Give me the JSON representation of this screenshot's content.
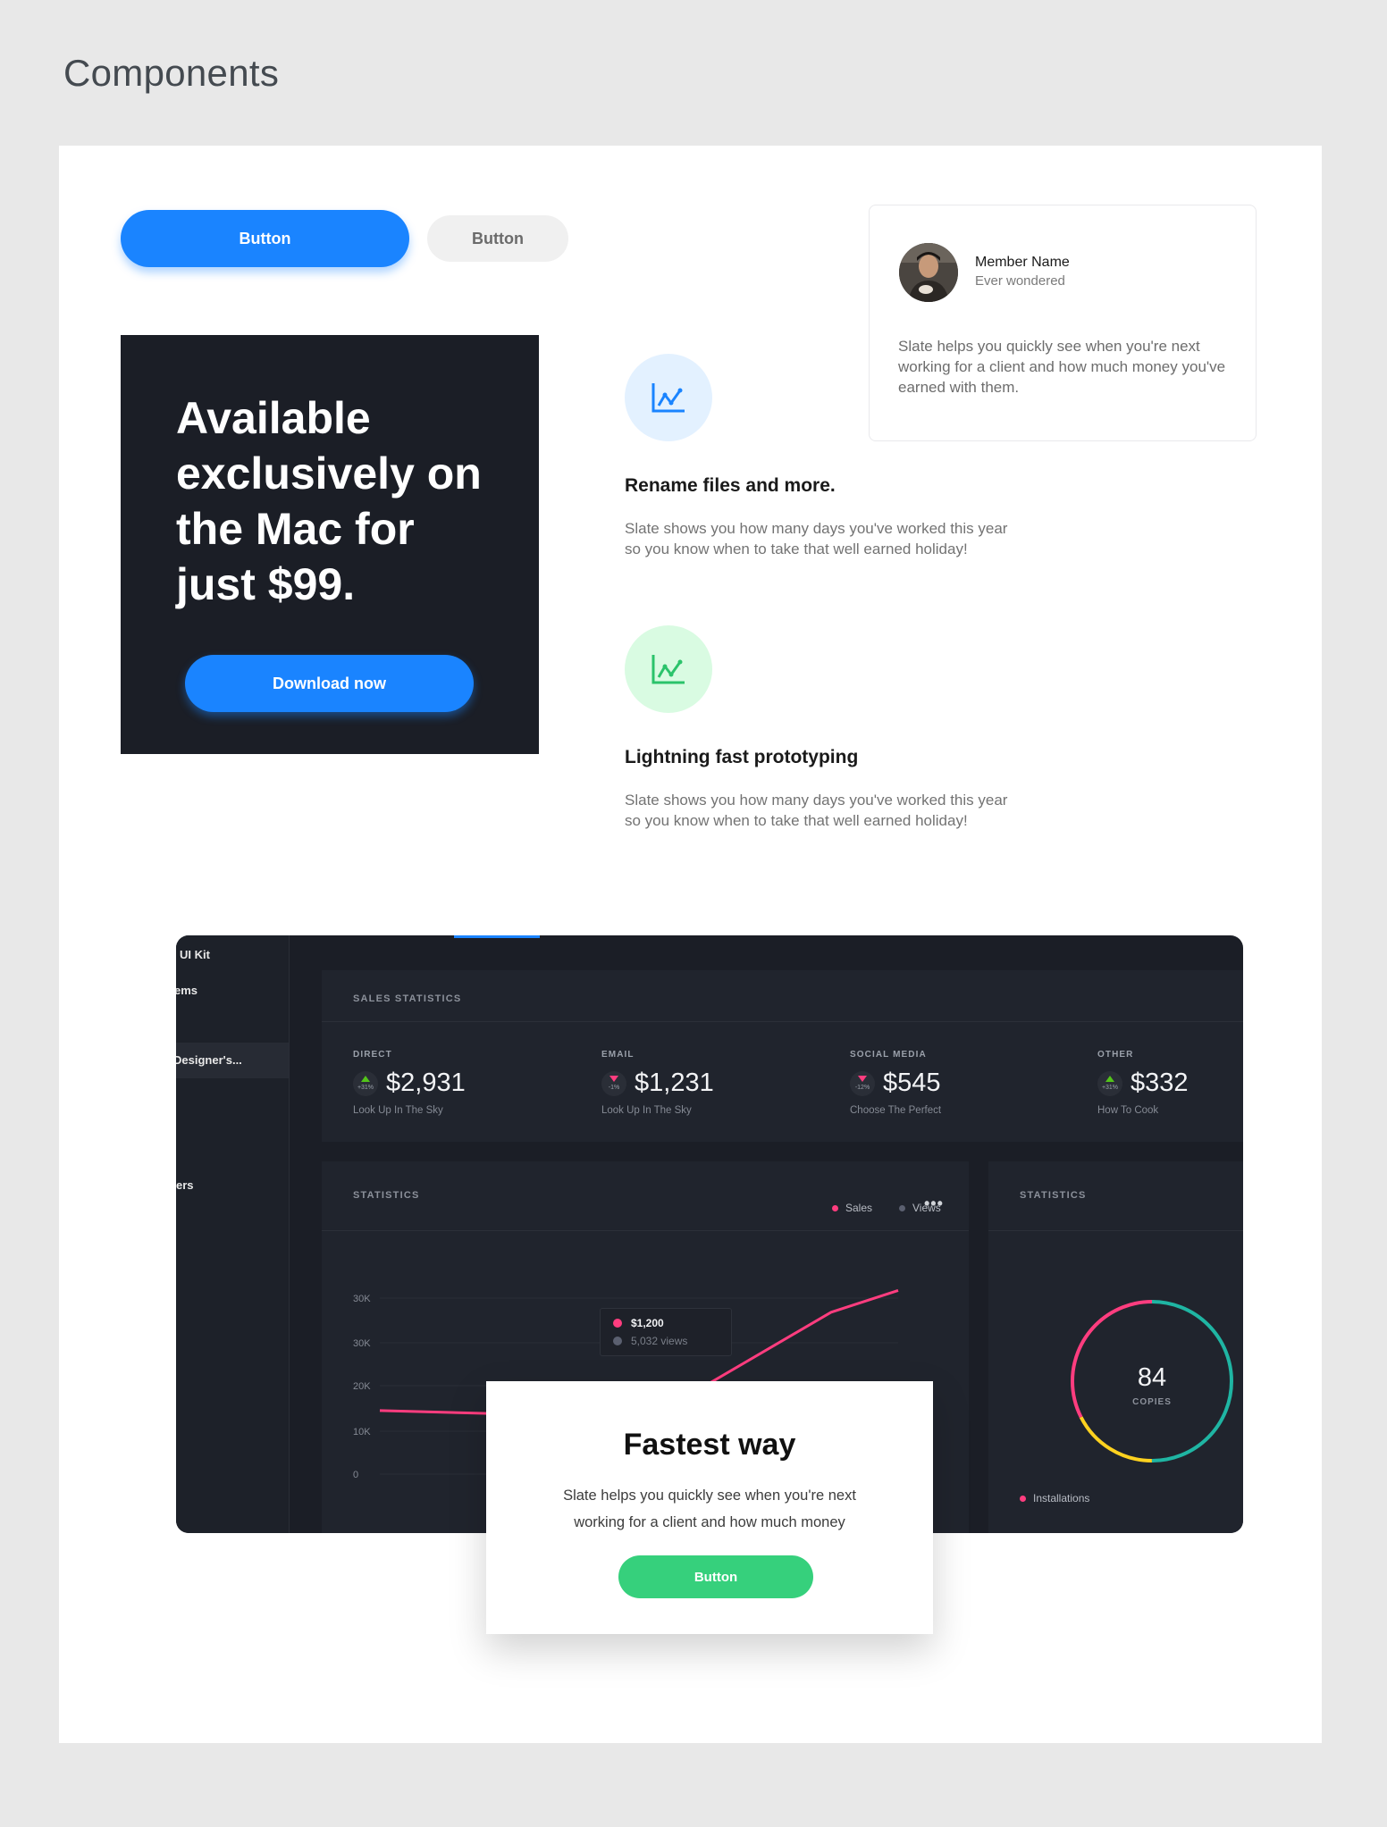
{
  "page": {
    "title": "Components"
  },
  "buttons": {
    "primary_label": "Button",
    "secondary_label": "Button"
  },
  "promo": {
    "headline": "Available exclusively on the Mac for just $99.",
    "cta_label": "Download now"
  },
  "features": [
    {
      "icon": "line-chart-icon",
      "title": "Rename files and more.",
      "description": "Slate shows you how many days you've worked this year so you know when to take that well earned holiday!",
      "icon_color": "#1a84ff",
      "bg_color": "#e3f1ff"
    },
    {
      "icon": "line-chart-icon",
      "title": "Lightning fast prototyping",
      "description": "Slate shows you how many days you've worked this year so you know when to take that well earned holiday!",
      "icon_color": "#2bc36b",
      "bg_color": "#d9fbe2"
    }
  ],
  "member_card": {
    "name": "Member Name",
    "subtitle": "Ever wondered",
    "text": "Slate helps you quickly see when you're next working for a client and how much money you've earned with them."
  },
  "dashboard": {
    "sidebar": [
      "UI Kit",
      "ems",
      "Designer's...",
      "ers"
    ],
    "sales_title": "SALES STATISTICS",
    "stats": [
      {
        "label": "DIRECT",
        "value": "$2,931",
        "change": "+31%",
        "trend": "up",
        "sub": "Look Up In The Sky"
      },
      {
        "label": "EMAIL",
        "value": "$1,231",
        "change": "-1%",
        "trend": "down",
        "sub": "Look Up In The Sky"
      },
      {
        "label": "SOCIAL MEDIA",
        "value": "$545",
        "change": "-12%",
        "trend": "down",
        "sub": "Choose The Perfect"
      },
      {
        "label": "OTHER",
        "value": "$332",
        "change": "+31%",
        "trend": "up",
        "sub": "How To Cook"
      }
    ],
    "statistics_title": "STATISTICS",
    "legend": [
      {
        "name": "Sales",
        "color": "#ff3d7f"
      },
      {
        "name": "Views",
        "color": "#5b6070"
      }
    ],
    "more_label": "•••",
    "y_ticks": [
      "30K",
      "30K",
      "20K",
      "10K",
      "0"
    ],
    "tooltip": {
      "value": "$1,200",
      "views": "5,032 views"
    },
    "donut": {
      "title": "STATISTICS",
      "value": "84",
      "label": "COPIES",
      "legend": "Installations"
    }
  },
  "modal": {
    "title": "Fastest way",
    "text": "Slate helps you quickly see when you're next working for a client and how much money",
    "button_label": "Button"
  },
  "colors": {
    "accent": "#1a84ff",
    "green": "#36d07c",
    "pink": "#ff3d7f",
    "teal": "#1fb5a3",
    "yellow": "#ffd21f",
    "dark": "#1b1e26"
  },
  "chart_data": {
    "type": "line",
    "title": "STATISTICS",
    "yticks": [
      "30K",
      "30K",
      "20K",
      "10K",
      "0"
    ],
    "series": [
      {
        "name": "Sales",
        "values": [
          10200,
          9500,
          12600,
          26000,
          29500
        ]
      }
    ],
    "x": [
      0,
      1,
      2,
      3,
      4
    ],
    "tooltip_point": {
      "x": 2,
      "value": "$1,200"
    }
  }
}
